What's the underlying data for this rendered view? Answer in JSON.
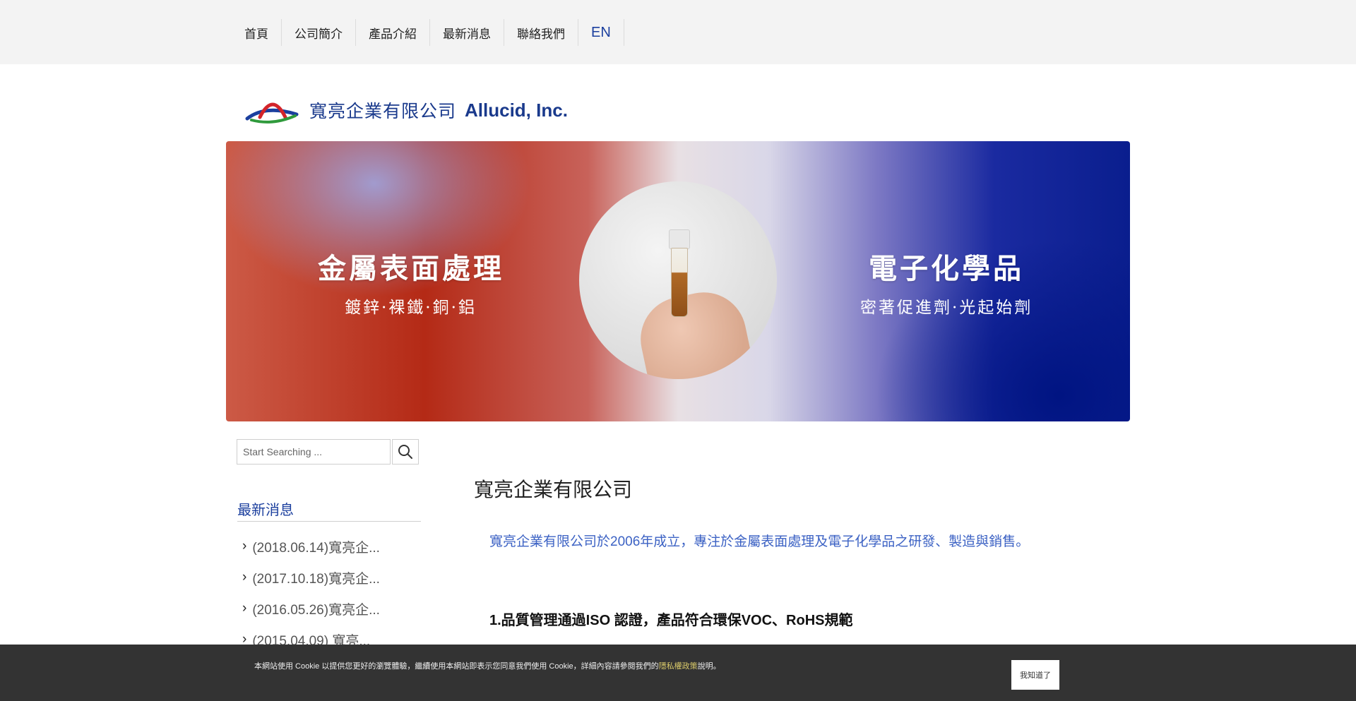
{
  "nav": {
    "items": [
      "首頁",
      "公司簡介",
      "產品介紹",
      "最新消息",
      "聯絡我們"
    ],
    "lang": "EN"
  },
  "logo": {
    "name_cn": "寬亮企業有限公司",
    "name_en": "Allucid, Inc."
  },
  "banner": {
    "left_title": "金屬表面處理",
    "left_sub": "鍍鋅·裸鐵·銅·鋁",
    "right_title": "電子化學品",
    "right_sub": "密著促進劑·光起始劑"
  },
  "search": {
    "placeholder": "Start Searching ..."
  },
  "sidebar": {
    "heading": "最新消息",
    "items": [
      "(2018.06.14)寬亮企...",
      "(2017.10.18)寬亮企...",
      "(2016.05.26)寬亮企...",
      "(2015.04.09) 寬亮..."
    ]
  },
  "content": {
    "title": "寬亮企業有限公司",
    "intro": "寬亮企業有限公司於2006年成立，專注於金屬表面處理及電子化學品之研發、製造與銷售。",
    "point1": "1.品質管理通過ISO 認證，產品符合環保VOC、RoHS規範"
  },
  "cookie": {
    "text": "本網站使用 Cookie 以提供您更好的瀏覽體驗，繼續使用本網站即表示您同意我們使用 Cookie，詳細內容請參閱我們的",
    "link": "隱私權政策",
    "tail": "說明。",
    "button": "我知道了"
  }
}
